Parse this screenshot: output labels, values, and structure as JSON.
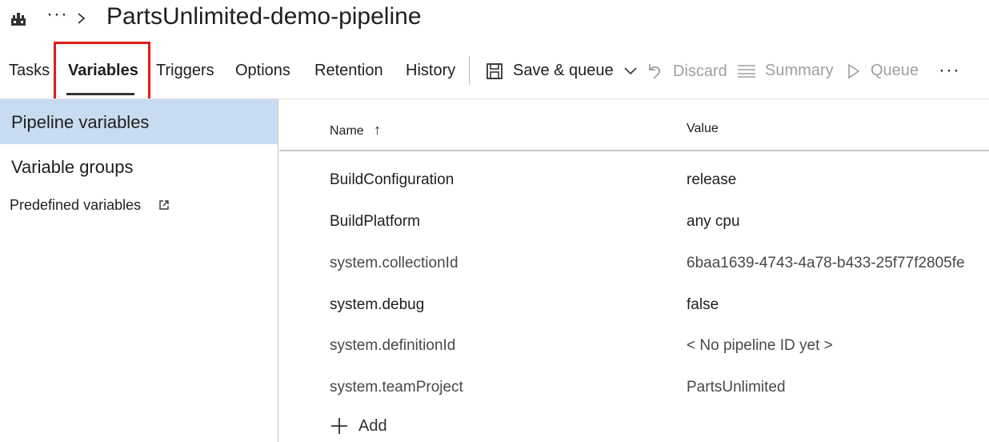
{
  "header": {
    "title": "PartsUnlimited-demo-pipeline",
    "more_glyph": "···",
    "icons": [
      "pipeline-icon",
      "chevron-right-icon"
    ]
  },
  "tabs": [
    {
      "label": "Tasks",
      "active": false
    },
    {
      "label": "Variables",
      "active": true
    },
    {
      "label": "Triggers",
      "active": false
    },
    {
      "label": "Options",
      "active": false
    },
    {
      "label": "Retention",
      "active": false
    },
    {
      "label": "History",
      "active": false
    }
  ],
  "toolbar": {
    "save_queue": "Save & queue",
    "discard": "Discard",
    "summary": "Summary",
    "queue": "Queue",
    "more": "···"
  },
  "leftnav": {
    "pipeline_variables": "Pipeline variables",
    "variable_groups": "Variable groups",
    "predefined_variables": "Predefined variables"
  },
  "table": {
    "name_header": "Name",
    "value_header": "Value",
    "sort_indicator": "↑",
    "rows": [
      {
        "name": "BuildConfiguration",
        "value": "release"
      },
      {
        "name": "BuildPlatform",
        "value": "any cpu"
      },
      {
        "name": "system.collectionId",
        "value": "6baa1639-4743-4a78-b433-25f77f2805fe"
      },
      {
        "name": "system.debug",
        "value": "false"
      },
      {
        "name": "system.definitionId",
        "value": "< No pipeline ID yet >"
      },
      {
        "name": "system.teamProject",
        "value": "PartsUnlimited"
      }
    ],
    "add_label": "Add"
  },
  "colors": {
    "selected_nav": "#c7dcf0",
    "highlight": "#e01b1b",
    "disabled": "#a19f9d"
  }
}
